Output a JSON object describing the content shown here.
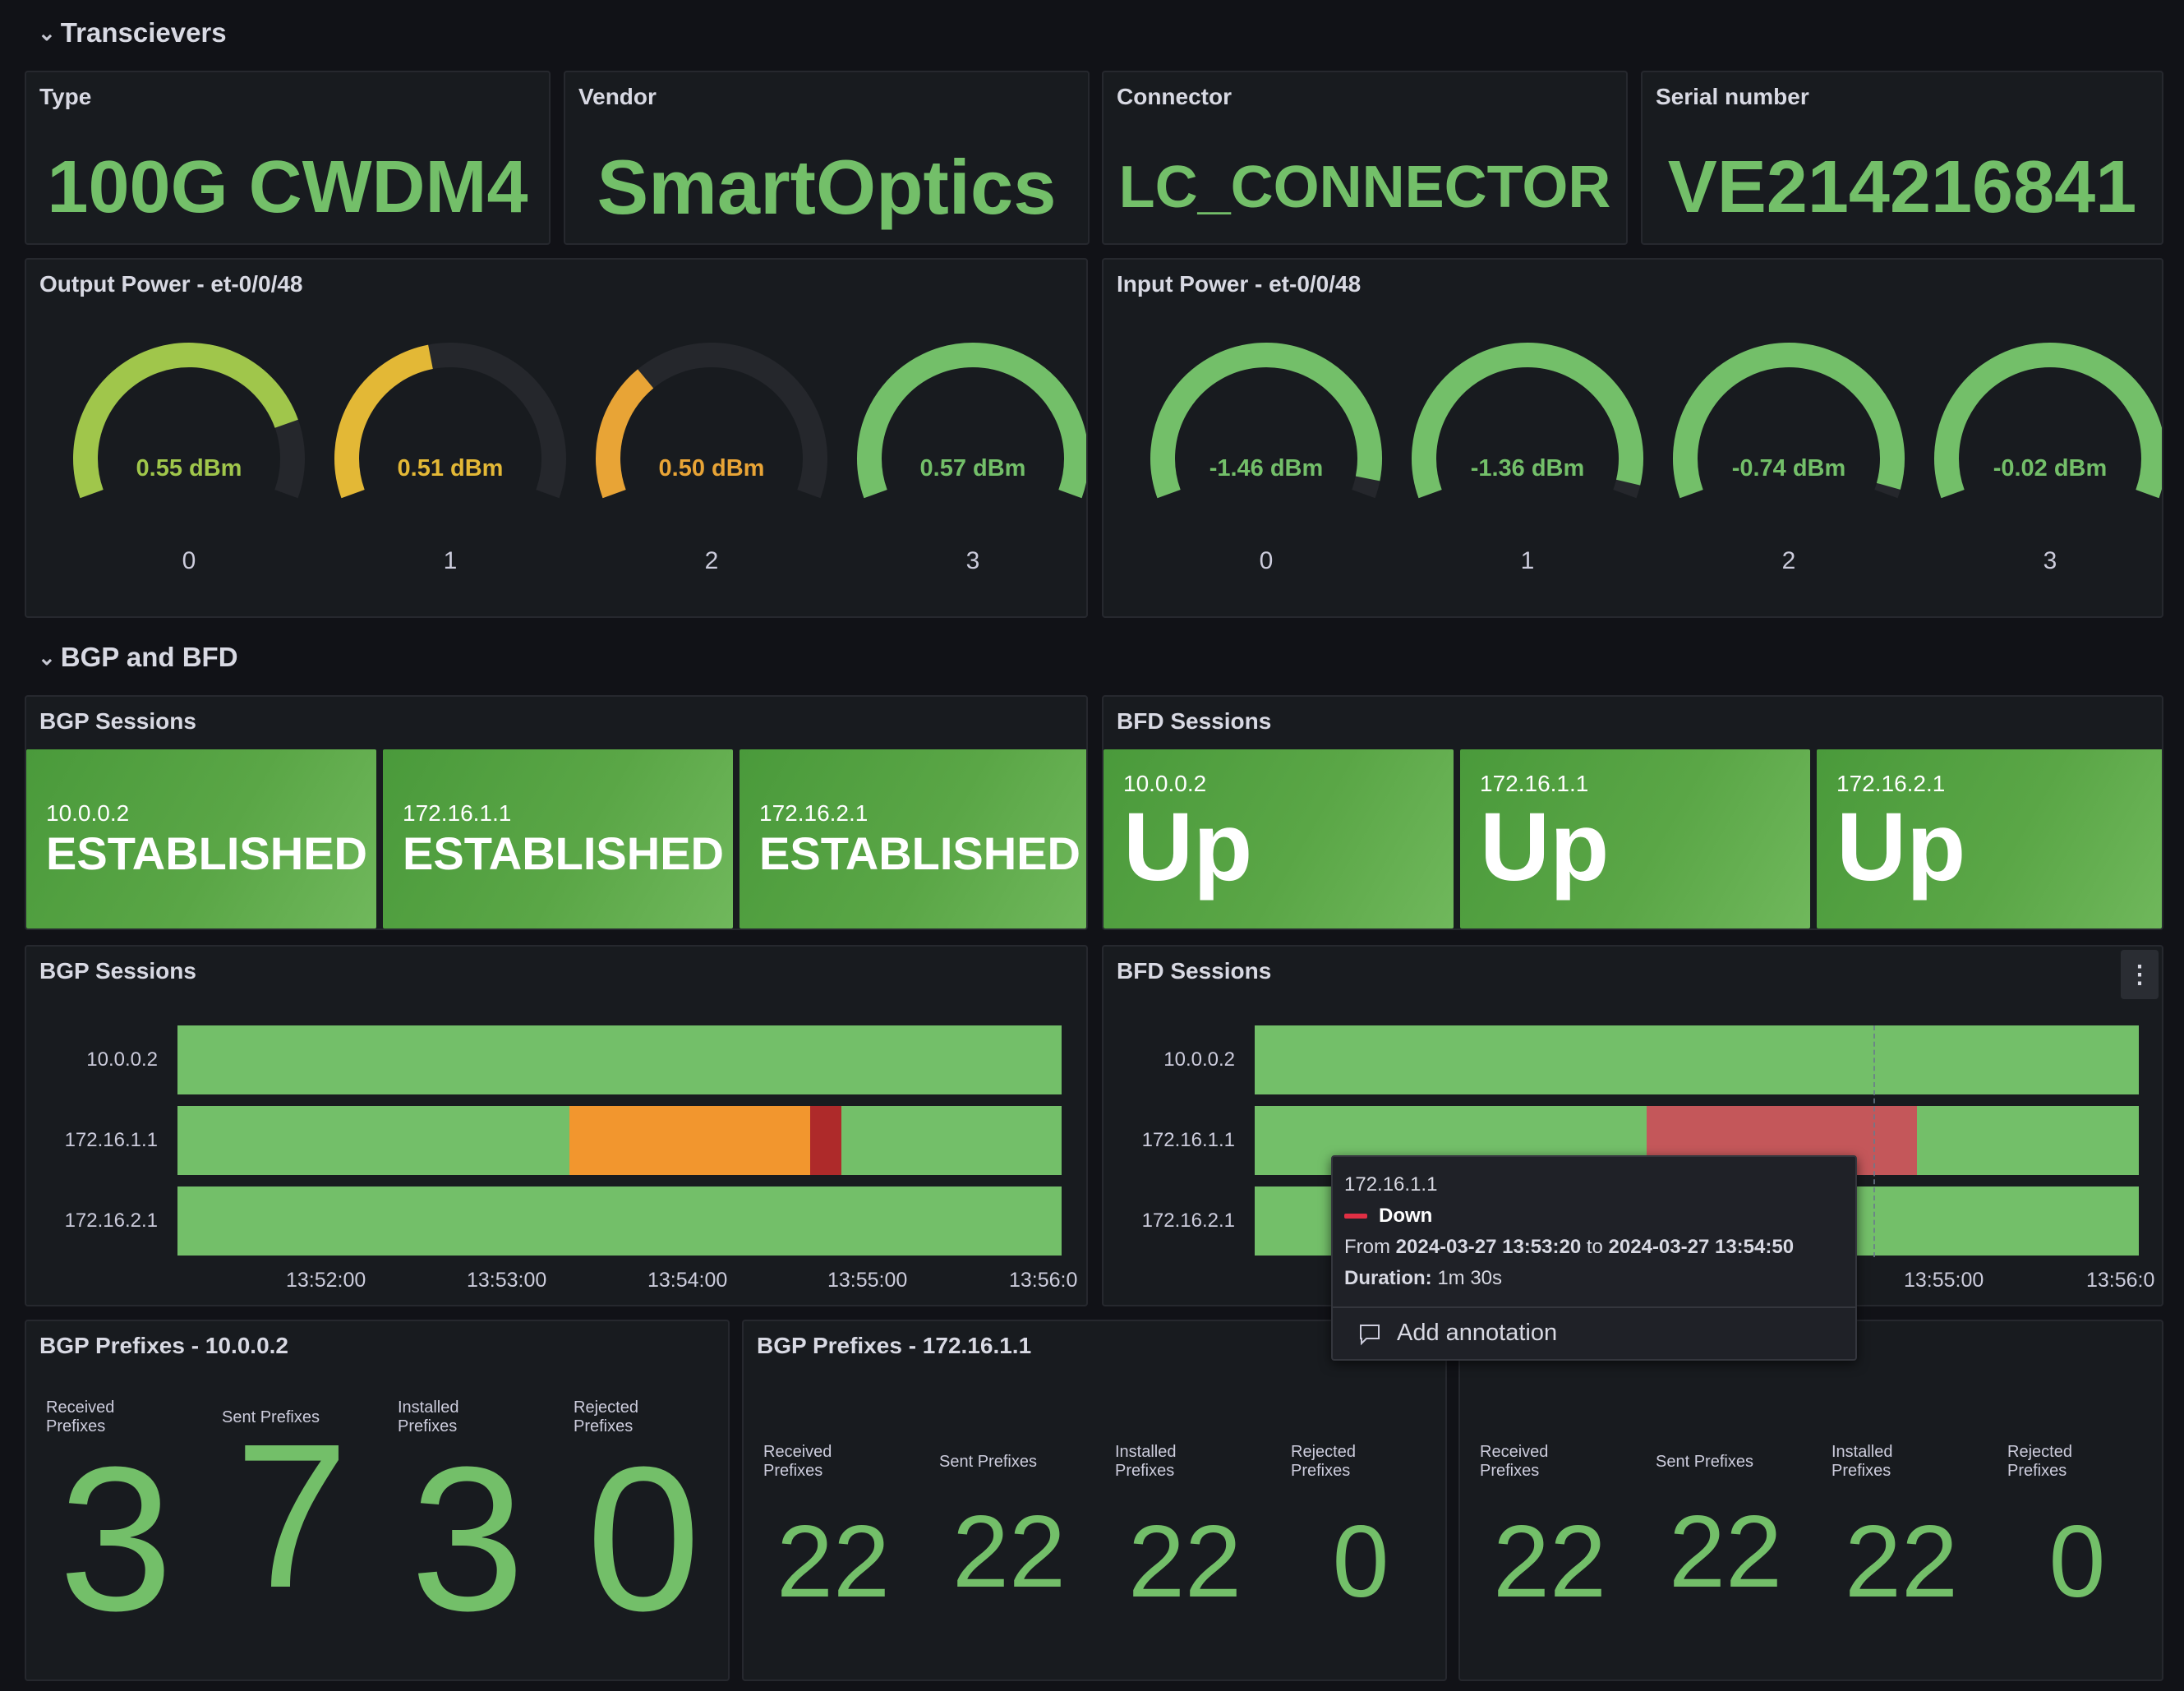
{
  "rows": {
    "transceivers": "Transcievers",
    "bgp_bfd": "BGP and BFD"
  },
  "stats": {
    "type": {
      "title": "Type",
      "value": "100G CWDM4"
    },
    "vendor": {
      "title": "Vendor",
      "value": "SmartOptics"
    },
    "connector": {
      "title": "Connector",
      "value": "LC_CONNECTOR"
    },
    "serial": {
      "title": "Serial number",
      "value": "VE214216841"
    }
  },
  "output_power": {
    "title": "Output Power - et-0/0/48",
    "gauges": [
      {
        "label": "0",
        "value": "0.55 dBm",
        "fraction": 0.82,
        "color": "#a0c64b",
        "text_color": "#a0c64b"
      },
      {
        "label": "1",
        "value": "0.51 dBm",
        "fraction": 0.45,
        "color": "#e3b836",
        "text_color": "#e3b836"
      },
      {
        "label": "2",
        "value": "0.50 dBm",
        "fraction": 0.32,
        "color": "#e8a436",
        "text_color": "#e8a436"
      },
      {
        "label": "3",
        "value": "0.57 dBm",
        "fraction": 1.0,
        "color": "#73bf69",
        "text_color": "#73bf69"
      }
    ]
  },
  "input_power": {
    "title": "Input Power - et-0/0/48",
    "gauges": [
      {
        "label": "0",
        "value": "-1.46 dBm",
        "fraction": 0.96,
        "color": "#73bf69",
        "text_color": "#73bf69"
      },
      {
        "label": "1",
        "value": "-1.36 dBm",
        "fraction": 0.97,
        "color": "#73bf69",
        "text_color": "#73bf69"
      },
      {
        "label": "2",
        "value": "-0.74 dBm",
        "fraction": 0.98,
        "color": "#73bf69",
        "text_color": "#73bf69"
      },
      {
        "label": "3",
        "value": "-0.02 dBm",
        "fraction": 1.0,
        "color": "#73bf69",
        "text_color": "#73bf69"
      }
    ]
  },
  "bgp_state": {
    "title": "BGP Sessions",
    "items": [
      {
        "name": "10.0.0.2",
        "value": "ESTABLISHED"
      },
      {
        "name": "172.16.1.1",
        "value": "ESTABLISHED"
      },
      {
        "name": "172.16.2.1",
        "value": "ESTABLISHED"
      }
    ]
  },
  "bfd_state": {
    "title": "BFD Sessions",
    "items": [
      {
        "name": "10.0.0.2",
        "value": "Up"
      },
      {
        "name": "172.16.1.1",
        "value": "Up"
      },
      {
        "name": "172.16.2.1",
        "value": "Up"
      }
    ]
  },
  "bgp_timeline": {
    "title": "BGP Sessions",
    "rows": [
      {
        "label": "10.0.0.2",
        "segments": [
          {
            "from": 0.0,
            "to": 1.0,
            "color": "#73bf69"
          }
        ]
      },
      {
        "label": "172.16.1.1",
        "segments": [
          {
            "from": 0.0,
            "to": 0.443,
            "color": "#73bf69"
          },
          {
            "from": 0.443,
            "to": 0.716,
            "color": "#f2962e"
          },
          {
            "from": 0.716,
            "to": 0.751,
            "color": "#ae2a2a"
          },
          {
            "from": 0.751,
            "to": 1.0,
            "color": "#73bf69"
          }
        ]
      },
      {
        "label": "172.16.2.1",
        "segments": [
          {
            "from": 0.0,
            "to": 1.0,
            "color": "#73bf69"
          }
        ]
      }
    ],
    "ticks": [
      "13:52:00",
      "13:53:00",
      "13:54:00",
      "13:55:00",
      "13:56:0"
    ]
  },
  "bfd_timeline": {
    "title": "BFD Sessions",
    "menu_icon": "kebab-menu-icon",
    "rows": [
      {
        "label": "10.0.0.2",
        "segments": [
          {
            "from": 0.0,
            "to": 1.0,
            "color": "#73bf69"
          }
        ]
      },
      {
        "label": "172.16.1.1",
        "segments": [
          {
            "from": 0.0,
            "to": 0.443,
            "color": "#73bf69"
          },
          {
            "from": 0.443,
            "to": 0.749,
            "color": "#c4575a"
          },
          {
            "from": 0.749,
            "to": 1.0,
            "color": "#73bf69"
          }
        ]
      },
      {
        "label": "172.16.2.1",
        "segments": [
          {
            "from": 0.0,
            "to": 1.0,
            "color": "#73bf69"
          }
        ]
      }
    ],
    "ticks": [
      "13:55:00",
      "13:56:0"
    ]
  },
  "tooltip": {
    "series": "172.16.1.1",
    "state": "Down",
    "state_color": "#e02f44",
    "range_prefix": "From",
    "range_from": "2024-03-27 13:53:20",
    "range_mid": "to",
    "range_to": "2024-03-27 13:54:50",
    "duration_label": "Duration:",
    "duration": "1m 30s",
    "annotation": "Add annotation",
    "annotation_icon": "comment-icon"
  },
  "prefixes": [
    {
      "title": "BGP Prefixes - 10.0.0.2",
      "columns": [
        {
          "label": "Received Prefixes",
          "value": "3"
        },
        {
          "label": "Sent Prefixes",
          "value": "7"
        },
        {
          "label": "Installed Prefixes",
          "value": "3"
        },
        {
          "label": "Rejected Prefixes",
          "value": "0"
        }
      ]
    },
    {
      "title": "BGP Prefixes - 172.16.1.1",
      "columns": [
        {
          "label": "Received Prefixes",
          "value": "22"
        },
        {
          "label": "Sent Prefixes",
          "value": "22"
        },
        {
          "label": "Installed Prefixes",
          "value": "22"
        },
        {
          "label": "Rejected Prefixes",
          "value": "0"
        }
      ]
    },
    {
      "title": "",
      "columns": [
        {
          "label": "Received Prefixes",
          "value": "22"
        },
        {
          "label": "Sent Prefixes",
          "value": "22"
        },
        {
          "label": "Installed Prefixes",
          "value": "22"
        },
        {
          "label": "Rejected Prefixes",
          "value": "0"
        }
      ]
    }
  ]
}
